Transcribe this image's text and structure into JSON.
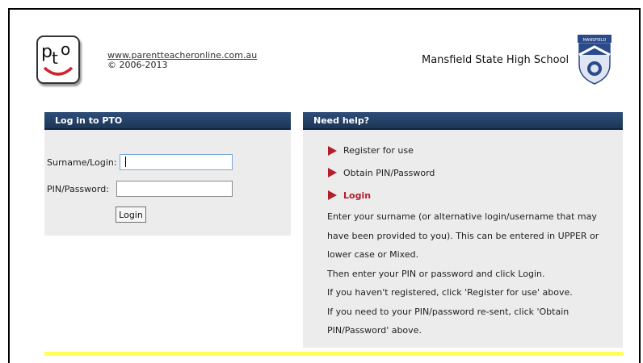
{
  "header": {
    "site_link": "www.parentteacheronline.com.au",
    "copyright": "© 2006-2013",
    "school_name": "Mansfield State High School",
    "crest_banner": "MANSFIELD",
    "logo_text": "PTO"
  },
  "login": {
    "title": "Log in to PTO",
    "surname_label": "Surname/Login:",
    "surname_value": "",
    "pin_label": "PIN/Password:",
    "pin_value": "",
    "login_button": "Login"
  },
  "help": {
    "title": "Need help?",
    "links": [
      {
        "label": "Register for use",
        "active": false
      },
      {
        "label": "Obtain PIN/Password",
        "active": false
      },
      {
        "label": "Login",
        "active": true
      }
    ],
    "lines": [
      "Enter your surname (or alternative login/username that may",
      "have been provided to you). This can be entered in UPPER or",
      "lower case or Mixed.",
      "Then enter your PIN or password and click Login.",
      "If you haven't registered, click 'Register for use' above.",
      "If you need to your PIN/password re-sent, click 'Obtain",
      "PIN/Password' above."
    ]
  },
  "colors": {
    "header_bar": "#1d3658",
    "panel_bg": "#ececec",
    "arrow": "#b21e2b",
    "highlight_bar": "#ffff55"
  }
}
